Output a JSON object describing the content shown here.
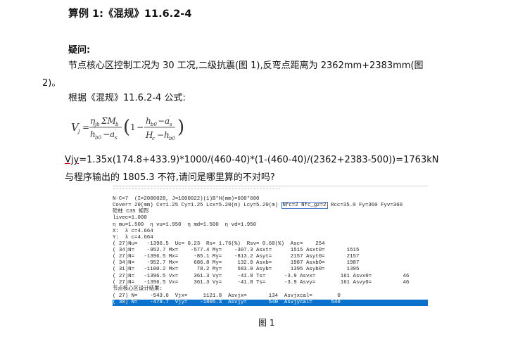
{
  "title": "算例 1:《混规》11.6.2-4",
  "question_label": "疑问:",
  "paragraph1": "节点核心区控制工况为 30 工况,二级抗震(图 1),反弯点距离为 2362mm+2383mm(图",
  "paragraph1_cont": "2)。",
  "paragraph2": "根据《混规》11.6.2-4 公式:",
  "formula": {
    "lhs": "V",
    "lhs_sub": "j",
    "eta": "η",
    "eta_sub": "jb",
    "sum": "ΣM",
    "sum_sub": "b",
    "h": "h",
    "h_sub": "b0",
    "a": "a",
    "a_sub": "s",
    "one": "1",
    "H": "H",
    "H_sub": "c"
  },
  "calc_prefix": "Vjy",
  "calc_rest": "=1.35x(174.8+433.9)*1000/(460-40)*(1-(460-40)/(2362+2383-500))=1763kN",
  "ask": "与程序输出的 1805.3 不符,请问是哪里算的不对吗?",
  "screenshot": {
    "dash_line": "------------------------------------------------------",
    "line_n": "N-C=7  (I=2000028, J=1000022)(1)B*H(mm)=600*600",
    "line_cover_a": "Cover= 20(mm) Cx=1.25 Cy=1.25 Lcx=5.20(m) Lcy=5.20(m) ",
    "line_cover_box": "Nfc=2 Nfc_gz=2",
    "line_cover_b": " Rcc=35.0 Fy=360 Fyv=360",
    "line_conc": "砼柱 C35 矩形",
    "line_livec": "livec=1.000",
    "line_eta": "η mu=1.500  η vu=1.950  η md=1.500  η vd=1.950",
    "line_x": "X:  λ c=4.664",
    "line_y": "Y:  λ c=4.664",
    "rows": [
      "( 27)Nu=   -1396.5  Uc= 0.23  Rs= 1.76(%)  Rsv= 0.60(%)  Asc=    254",
      "( 34)N=    -952.7 Mx=    -577.4 My=    -307.3 Asxt=      1515 Asxt0=       1515",
      "( 27)N=   -1396.5 Mx=     -85.1 My=    -813.2 Asyt=      2157 Asyt0=       2157",
      "( 34)N=    -952.7 Mx=     686.8 My=     132.0 Asxb=      1987 Asxb0=       1987",
      "( 31)N=   -1100.2 Mx=      78.2 My=     583.0 Asyb=      1395 Asyb0=       1395",
      "( 27)N=   -1396.5 Vx=     361.3 Vy=     -41.8 Ts=      -3.9 Asvx=        161 Asvx0=          46",
      "( 27)N=   -1396.5 Vx=     361.3 Vy=     -41.8 Ts=      -3.9 Asvy=        161 Asvy0=          46"
    ],
    "core_title": "节点核心区设计结果:",
    "core_row1": "( 27) N=    -543.6  Vjx=     1121.8  Asvjx=       134  Asvjxcal=        0",
    "core_row2": "( 30) N=    -478.7  Vjy=    -1805.3  Asvjy=       540  Asvjycal=      540"
  },
  "caption": "图 1"
}
